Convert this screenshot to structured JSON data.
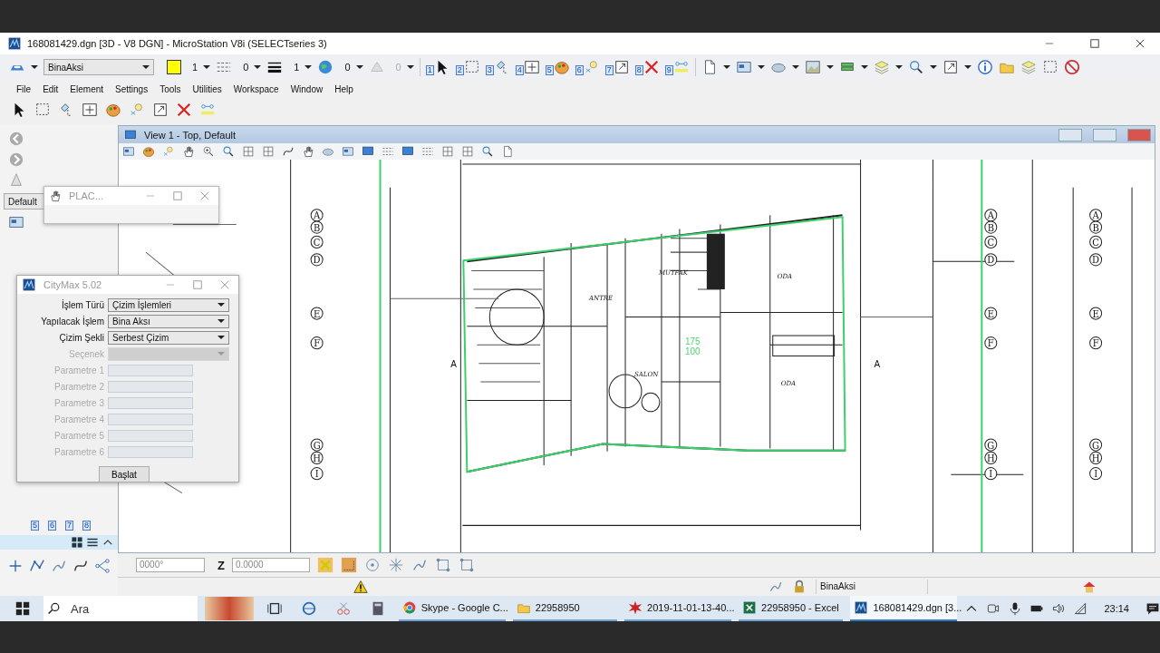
{
  "window": {
    "title": "168081429.dgn [3D - V8 DGN] - MicroStation V8i (SELECTseries 3)"
  },
  "attributes": {
    "level_name": "BinaAksi",
    "color_number": "1",
    "style": "0",
    "weight": "1",
    "transparency": "0",
    "priority": {
      "value": "0",
      "disabled": true
    }
  },
  "task_numbers": [
    "1",
    "2",
    "3",
    "4",
    "5",
    "6",
    "7",
    "8",
    "9"
  ],
  "menu": [
    "File",
    "Edit",
    "Element",
    "Settings",
    "Tools",
    "Utilities",
    "Workspace",
    "Window",
    "Help"
  ],
  "left_panel": {
    "view_group": "Default",
    "task_numbers": [
      "5",
      "6",
      "7",
      "8"
    ]
  },
  "view": {
    "title": "View 1 - Top, Default"
  },
  "plan": {
    "axis_columns": [
      [
        "A",
        "B",
        "C",
        "D",
        "E",
        "F",
        "G",
        "H",
        "I"
      ],
      [
        "A",
        "B",
        "C",
        "D",
        "E",
        "F",
        "G",
        "H",
        "I"
      ],
      [
        "A",
        "B",
        "C",
        "D",
        "E",
        "F",
        "G",
        "H",
        "I"
      ]
    ],
    "rooms": [
      "MUTFAK",
      "ODA",
      "ANTRE",
      "SALON",
      "ODA"
    ],
    "section_marks": [
      "A",
      "A"
    ],
    "green_values": [
      "175",
      "100"
    ]
  },
  "plac_dialog": {
    "title": "PLAC..."
  },
  "citymax": {
    "title": "CityMax 5.02",
    "fields": [
      {
        "kind": "dropdown",
        "label": "İşlem Türü",
        "value": "Çizim İşlemleri",
        "disabled": false
      },
      {
        "kind": "dropdown",
        "label": "Yapılacak İşlem",
        "value": "Bina Aksı",
        "disabled": false
      },
      {
        "kind": "dropdown",
        "label": "Çizim Şekli",
        "value": "Serbest Çizim",
        "disabled": false
      },
      {
        "kind": "dropdown",
        "label": "Seçenek",
        "disabled": true
      },
      {
        "kind": "text",
        "label": "Parametre 1",
        "disabled": true
      },
      {
        "kind": "text",
        "label": "Parametre 2",
        "disabled": true
      },
      {
        "kind": "text",
        "label": "Parametre 3",
        "disabled": true
      },
      {
        "kind": "text",
        "label": "Parametre 4",
        "disabled": true
      },
      {
        "kind": "text",
        "label": "Parametre 5",
        "disabled": true
      },
      {
        "kind": "text",
        "label": "Parametre 6",
        "disabled": true
      }
    ],
    "button": "Başlat"
  },
  "accudraw": {
    "angle_value": "0000°",
    "z_label": "Z",
    "z_value": "0.0000"
  },
  "status_bar": {
    "level_name": "BinaAksi"
  },
  "taskbar": {
    "search_placeholder": "Ara",
    "apps": [
      {
        "label": "Skype - Google C...",
        "selected": false
      },
      {
        "label": "22958950",
        "selected": false
      },
      {
        "label": "2019-11-01-13-40...",
        "selected": false
      },
      {
        "label": "22958950 - Excel",
        "selected": false
      },
      {
        "label": "168081429.dgn [3...",
        "selected": true
      }
    ],
    "clock": "23:14"
  }
}
